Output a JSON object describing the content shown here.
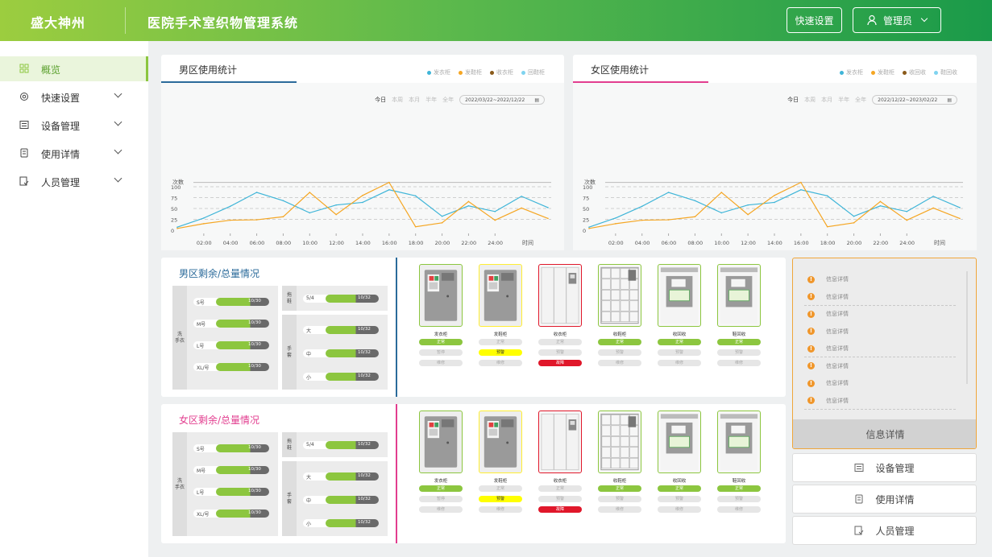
{
  "header": {
    "brand": "盛大神州",
    "title": "医院手术室织物管理系统",
    "quick_settings": "快速设置",
    "admin": "管理员"
  },
  "sidebar": {
    "items": [
      {
        "label": "概览",
        "icon": "grid-icon",
        "active": true
      },
      {
        "label": "快速设置",
        "icon": "settings-icon"
      },
      {
        "label": "设备管理",
        "icon": "device-icon"
      },
      {
        "label": "使用详情",
        "icon": "detail-icon"
      },
      {
        "label": "人员管理",
        "icon": "people-icon"
      }
    ]
  },
  "colors": {
    "accent": "#8cc63f",
    "male": "#2a6a9a",
    "female": "#e23d8f",
    "series_blue": "#3fb5d8",
    "series_orange": "#f5a623",
    "alert": "#e0172a",
    "warn": "#ffff00",
    "info": "#f0962a"
  },
  "charts": [
    {
      "title": "男区使用统计",
      "periods": [
        "今日",
        "本周",
        "本月",
        "半年",
        "全年"
      ],
      "date_range": "2022/03/22~2022/12/22",
      "legend": [
        "发衣柜",
        "发鞋柜",
        "收衣柜",
        "回鞋柜"
      ]
    },
    {
      "title": "女区使用统计",
      "periods": [
        "今日",
        "本周",
        "本月",
        "半年",
        "全年"
      ],
      "date_range": "2022/12/22~2023/02/22",
      "legend": [
        "发衣柜",
        "发鞋柜",
        "收回收",
        "鞋回收"
      ]
    }
  ],
  "chart_data": [
    {
      "type": "line",
      "ylabel": "次数",
      "xlabel": "时间",
      "ylim": [
        0,
        110
      ],
      "yticks": [
        0,
        25,
        50,
        75,
        100
      ],
      "x": [
        "",
        "02:00",
        "04:00",
        "06:00",
        "08:00",
        "10:00",
        "12:00",
        "14:00",
        "16:00",
        "18:00",
        "20:00",
        "22:00",
        "24:00",
        "",
        ""
      ],
      "series": [
        {
          "values": [
            7,
            28,
            55,
            87,
            68,
            40,
            58,
            64,
            93,
            79,
            32,
            56,
            43,
            78,
            52
          ]
        },
        {
          "values": [
            4,
            15,
            23,
            24,
            31,
            87,
            36,
            80,
            110,
            8,
            17,
            66,
            23,
            51,
            27
          ]
        }
      ]
    },
    {
      "type": "line",
      "ylabel": "次数",
      "xlabel": "时间",
      "ylim": [
        0,
        110
      ],
      "yticks": [
        0,
        25,
        50,
        75,
        100
      ],
      "x": [
        "",
        "02:00",
        "04:00",
        "06:00",
        "08:00",
        "10:00",
        "12:00",
        "14:00",
        "16:00",
        "18:00",
        "20:00",
        "22:00",
        "24:00",
        "",
        ""
      ],
      "series": [
        {
          "values": [
            7,
            28,
            55,
            87,
            68,
            40,
            58,
            64,
            93,
            79,
            32,
            56,
            43,
            78,
            52
          ]
        },
        {
          "values": [
            4,
            15,
            23,
            24,
            31,
            87,
            36,
            80,
            110,
            8,
            17,
            66,
            23,
            51,
            27
          ]
        }
      ]
    }
  ],
  "zones": [
    {
      "title": "男区剩余/总量情况",
      "color_key": "male",
      "g1_label": [
        "洗",
        "手衣"
      ],
      "g1": [
        {
          "size": "S号",
          "val": "10/30",
          "fill": 0.45
        },
        {
          "size": "M号",
          "val": "10/30",
          "fill": 0.45
        },
        {
          "size": "L号",
          "val": "10/30",
          "fill": 0.45
        },
        {
          "size": "XL/号",
          "val": "10/30",
          "fill": 0.45
        }
      ],
      "g2_label": [
        "拖",
        "鞋"
      ],
      "g2": [
        {
          "size": "5/4",
          "val": "10/32",
          "fill": 0.4
        }
      ],
      "g3_label": [
        "手",
        "套"
      ],
      "g3": [
        {
          "size": "大",
          "val": "10/32",
          "fill": 0.4
        },
        {
          "size": "中",
          "val": "10/32",
          "fill": 0.4
        },
        {
          "size": "小",
          "val": "10/32",
          "fill": 0.4
        }
      ]
    },
    {
      "title": "女区剩余/总量情况",
      "color_key": "female",
      "g1_label": [
        "洗",
        "手衣"
      ],
      "g1": [
        {
          "size": "S号",
          "val": "10/30",
          "fill": 0.45
        },
        {
          "size": "M号",
          "val": "10/30",
          "fill": 0.45
        },
        {
          "size": "L号",
          "val": "10/30",
          "fill": 0.45
        },
        {
          "size": "XL/号",
          "val": "10/30",
          "fill": 0.45
        }
      ],
      "g2_label": [
        "拖",
        "鞋"
      ],
      "g2": [
        {
          "size": "5/4",
          "val": "10/32",
          "fill": 0.4
        }
      ],
      "g3_label": [
        "手",
        "套"
      ],
      "g3": [
        {
          "size": "大",
          "val": "10/32",
          "fill": 0.4
        },
        {
          "size": "中",
          "val": "10/32",
          "fill": 0.4
        },
        {
          "size": "小",
          "val": "10/32",
          "fill": 0.4
        }
      ]
    }
  ],
  "cabinets": [
    {
      "name": "发衣柜",
      "type": "kiosk",
      "border": "#8cc63f",
      "status": "正常",
      "status_style": "ok",
      "pills": [
        "正常",
        "暂停",
        "维修"
      ]
    },
    {
      "name": "发鞋柜",
      "type": "kiosk",
      "border": "#ffee33",
      "status": "预警",
      "status_style": "warn",
      "pills": [
        "正常",
        "预警",
        "维修"
      ]
    },
    {
      "name": "收衣柜",
      "type": "doors",
      "border": "#e0172a",
      "status": "故障",
      "status_style": "alert",
      "pills": [
        "正常",
        "预警",
        "故障"
      ]
    },
    {
      "name": "收鞋柜",
      "type": "lockers",
      "border": "#8cc63f",
      "status": "正常",
      "status_style": "ok",
      "pills": [
        "正常",
        "预警",
        "维修"
      ]
    },
    {
      "name": "收回收",
      "type": "washer",
      "border": "#8cc63f",
      "status": "正常",
      "status_style": "ok",
      "pills": [
        "正常",
        "预警",
        "维修"
      ]
    },
    {
      "name": "鞋回收",
      "type": "washer2",
      "border": "#8cc63f",
      "status": "正常",
      "status_style": "ok",
      "pills": [
        "正常",
        "预警",
        "维修"
      ]
    }
  ],
  "info": {
    "items": [
      "信息详情",
      "信息详情",
      "信息详情",
      "信息详情",
      "信息详情",
      "信息详情",
      "信息详情",
      "信息详情"
    ],
    "footer": "信息详情"
  },
  "shortcuts": [
    {
      "label": "设备管理",
      "icon": "device-icon"
    },
    {
      "label": "使用详情",
      "icon": "detail-icon"
    },
    {
      "label": "人员管理",
      "icon": "people-icon"
    }
  ]
}
